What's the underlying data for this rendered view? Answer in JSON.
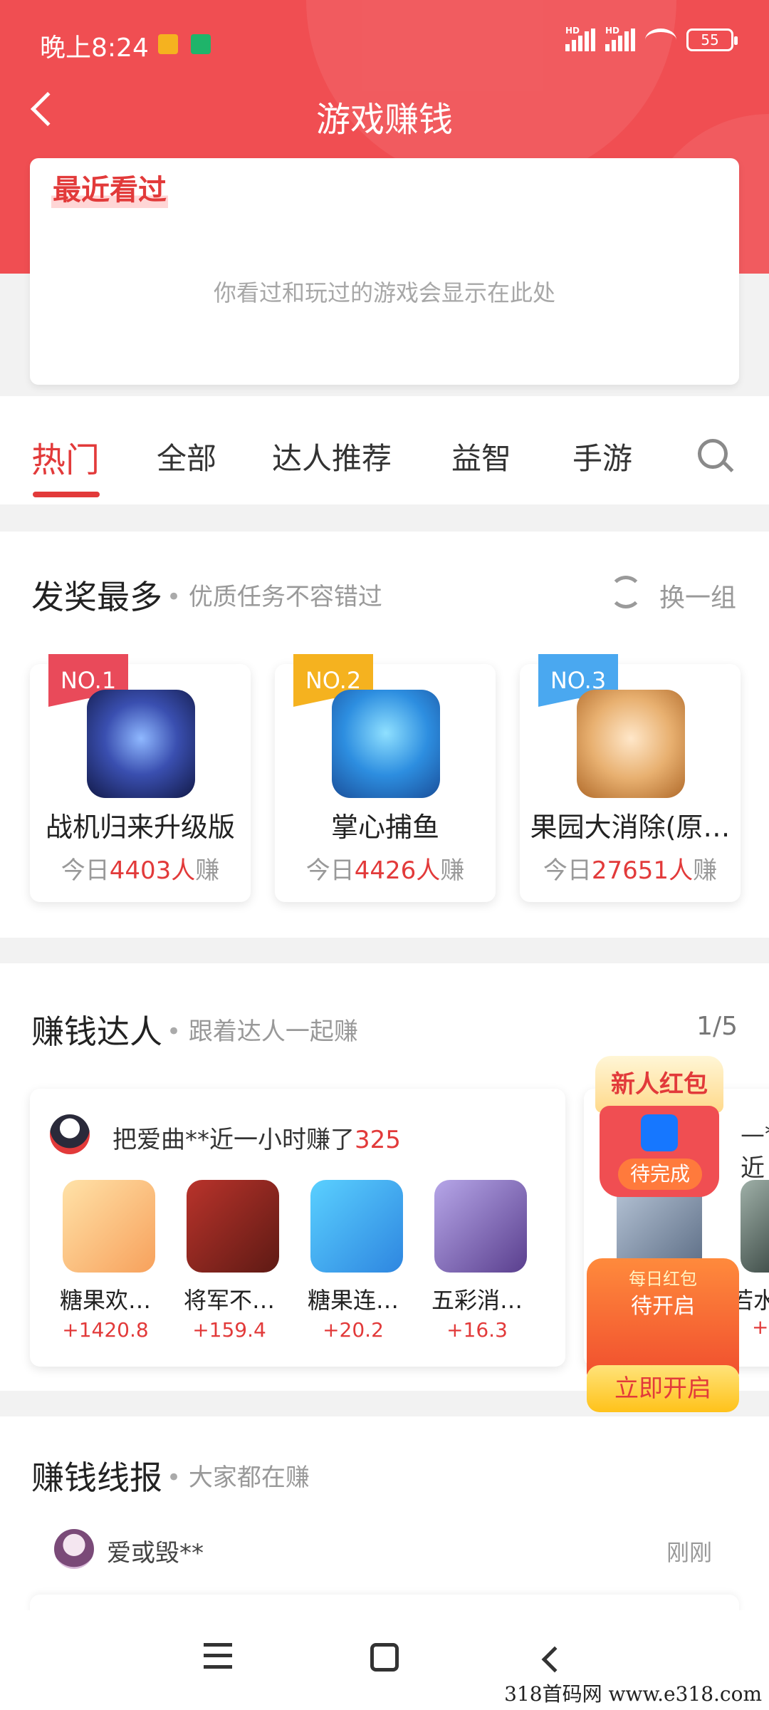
{
  "status": {
    "time": "晚上8:24",
    "battery": "55",
    "network": "HD"
  },
  "header": {
    "title": "游戏赚钱"
  },
  "recent": {
    "title": "最近看过",
    "empty_text": "你看过和玩过的游戏会显示在此处"
  },
  "tabs": [
    {
      "label": "热门",
      "active": true
    },
    {
      "label": "全部"
    },
    {
      "label": "达人推荐"
    },
    {
      "label": "益智"
    },
    {
      "label": "手游"
    }
  ],
  "awards": {
    "title": "发奖最多",
    "subtitle": "优质任务不容错过",
    "refresh_label": "换一组",
    "games": [
      {
        "rank": "NO.1",
        "name": "战机归来升级版",
        "prefix": "今日",
        "count": "4403人",
        "suffix": "赚",
        "badge_color": "#e94a5a"
      },
      {
        "rank": "NO.2",
        "name": "掌心捕鱼",
        "prefix": "今日",
        "count": "4426人",
        "suffix": "赚",
        "badge_color": "#f5b21f"
      },
      {
        "rank": "NO.3",
        "name": "果园大消除(原…",
        "prefix": "今日",
        "count": "27651人",
        "suffix": "赚",
        "badge_color": "#4aa8f0"
      }
    ]
  },
  "experts": {
    "title": "赚钱达人",
    "subtitle": "跟着达人一起赚",
    "page": "1/5",
    "card": {
      "user_text": "把爱曲**近一小时赚了",
      "amount": "325",
      "games": [
        {
          "name": "糖果欢…",
          "value": "+1420.8"
        },
        {
          "name": "将军不…",
          "value": "+159.4"
        },
        {
          "name": "糖果连…",
          "value": "+20.2"
        },
        {
          "name": "五彩消…",
          "value": "+16.3"
        }
      ]
    },
    "card2": {
      "user_text": "—**近",
      "game_name": "若水",
      "value": "+"
    }
  },
  "promo": {
    "new_user_title": "新人红包",
    "new_user_status": "待完成",
    "daily_line1": "每日红包",
    "daily_line2": "待开启",
    "daily_button": "立即开启"
  },
  "news": {
    "title": "赚钱线报",
    "subtitle": "大家都在赚",
    "user": "爱或毁**",
    "time": "刚刚"
  },
  "watermark": "318首码网 www.e318.com"
}
